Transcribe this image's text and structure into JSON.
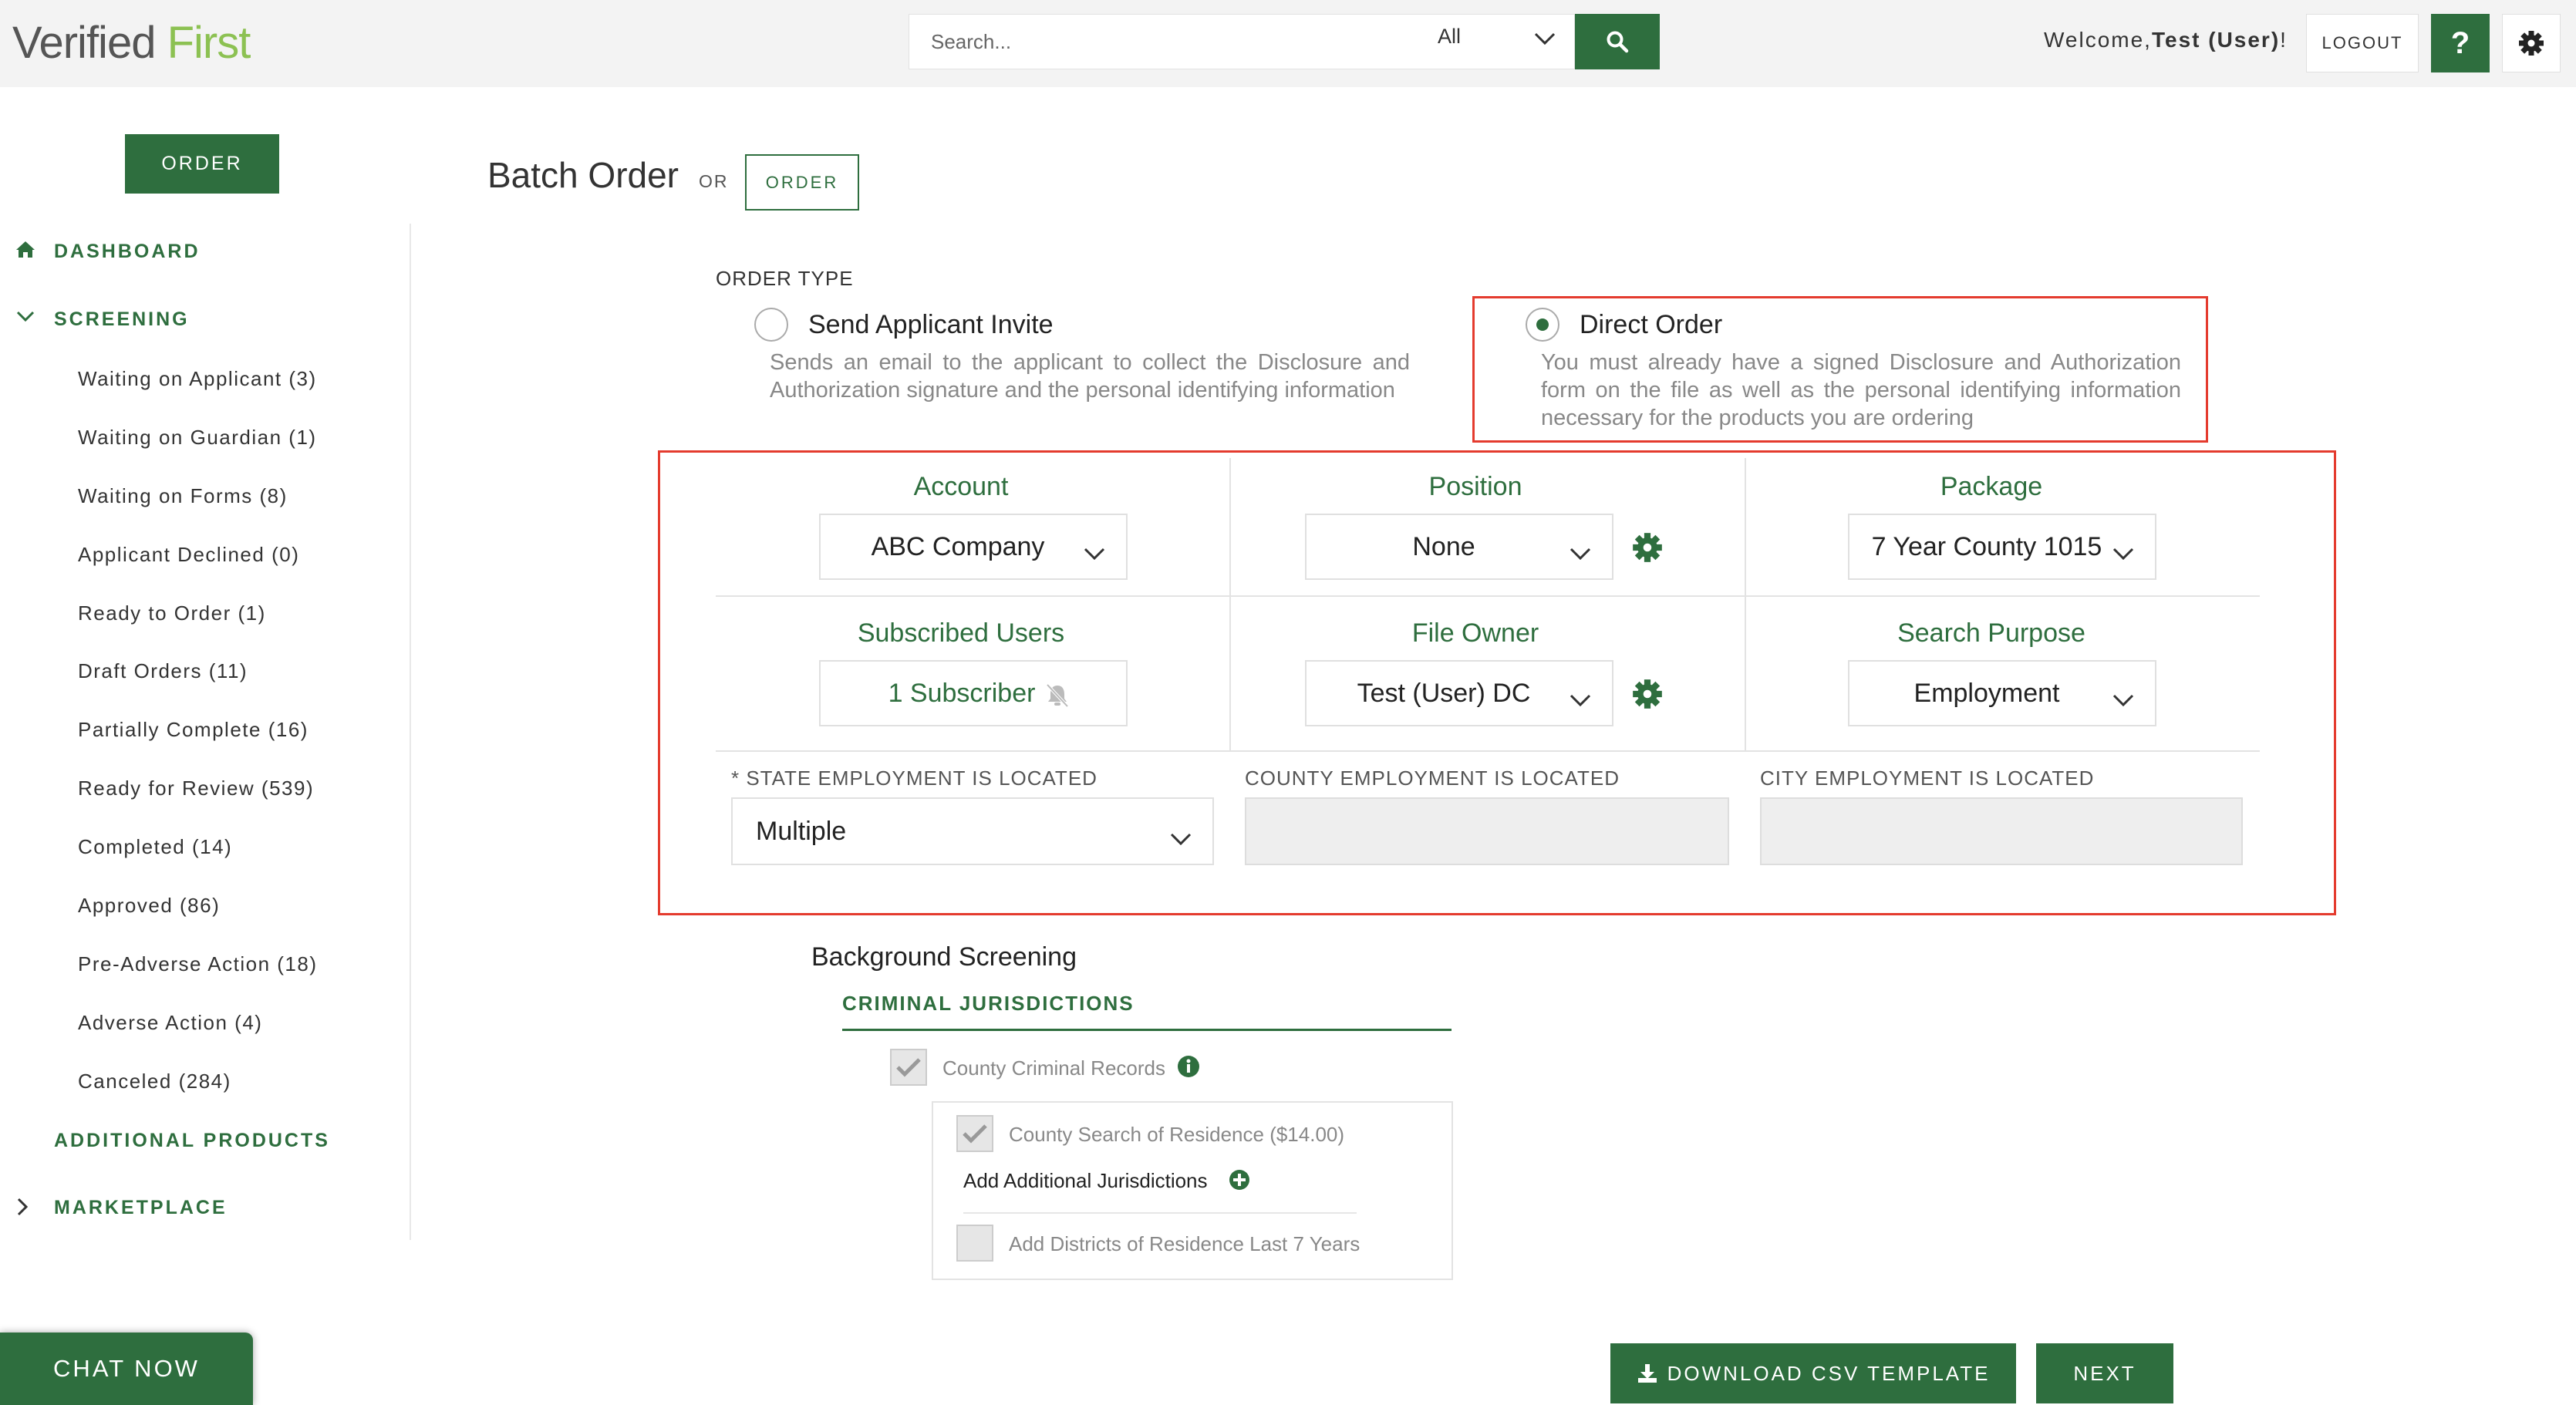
{
  "header": {
    "logo_part1": "Verified",
    "logo_part2": "First",
    "search_placeholder": "Search...",
    "search_scope": "All",
    "welcome_prefix": "Welcome,",
    "welcome_user": "Test (User)",
    "welcome_suffix": "!",
    "logout_label": "LOGOUT",
    "help_label": "?"
  },
  "sidebar": {
    "order_label": "ORDER",
    "dashboard_label": "DASHBOARD",
    "screening_label": "SCREENING",
    "items": [
      {
        "label": "Waiting on Applicant (3)"
      },
      {
        "label": "Waiting on Guardian (1)"
      },
      {
        "label": "Waiting on Forms (8)"
      },
      {
        "label": "Applicant Declined (0)"
      },
      {
        "label": "Ready to Order (1)"
      },
      {
        "label": "Draft Orders (11)"
      },
      {
        "label": "Partially Complete (16)"
      },
      {
        "label": "Ready for Review (539)"
      },
      {
        "label": "Completed (14)"
      },
      {
        "label": "Approved (86)"
      },
      {
        "label": "Pre-Adverse Action (18)"
      },
      {
        "label": "Adverse Action (4)"
      },
      {
        "label": "Canceled (284)"
      }
    ],
    "additional_products_label": "ADDITIONAL PRODUCTS",
    "marketplace_label": "MARKETPLACE"
  },
  "main": {
    "title": "Batch Order",
    "or_label": "OR",
    "order_button": "ORDER",
    "order_type_label": "ORDER TYPE",
    "options": [
      {
        "title": "Send Applicant Invite",
        "description": "Sends an email to the applicant to collect the Disclosure and Authorization signature and the personal identifying information",
        "selected": false
      },
      {
        "title": "Direct Order",
        "description": "You must already have a signed Disclosure and Authorization form on the file as well as the personal identifying information necessary for the products you are ordering",
        "selected": true
      }
    ]
  },
  "form": {
    "account_label": "Account",
    "account_value": "ABC Company",
    "position_label": "Position",
    "position_value": "None",
    "package_label": "Package",
    "package_value": "7 Year County 1015",
    "subscribed_label": "Subscribed Users",
    "subscribed_value": "1 Subscriber",
    "file_owner_label": "File Owner",
    "file_owner_value": "Test (User) DC",
    "search_purpose_label": "Search Purpose",
    "search_purpose_value": "Employment",
    "state_label": "* STATE EMPLOYMENT IS LOCATED",
    "state_value": "Multiple",
    "county_label": "COUNTY EMPLOYMENT IS LOCATED",
    "county_value": "",
    "city_label": "CITY EMPLOYMENT IS LOCATED",
    "city_value": ""
  },
  "screening": {
    "title": "Background Screening",
    "section_title": "CRIMINAL JURISDICTIONS",
    "county_records_label": "County Criminal Records",
    "county_search_label": "County Search of Residence ($14.00)",
    "add_jurisdictions_label": "Add Additional Jurisdictions",
    "add_districts_label": "Add Districts of Residence Last 7 Years"
  },
  "footer": {
    "download_label": "DOWNLOAD CSV TEMPLATE",
    "next_label": "NEXT",
    "chat_label": "CHAT NOW"
  },
  "colors": {
    "brand_green": "#2e6e3e",
    "logo_green": "#8cc152",
    "highlight_red": "#e43b2e"
  }
}
